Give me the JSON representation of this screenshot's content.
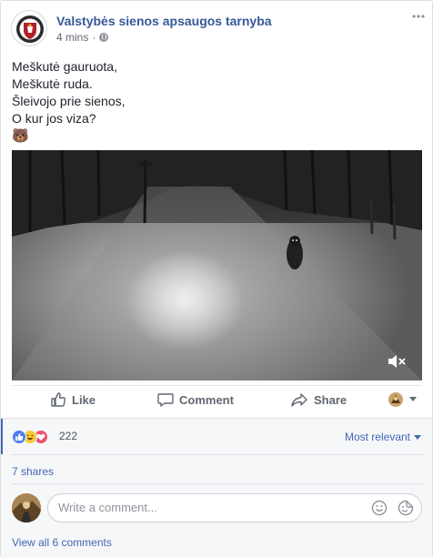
{
  "post": {
    "page_name": "Valstybės sienos apsaugos tarnyba",
    "time": "4 mins",
    "separator": "·",
    "more_icon": "more-dots-icon",
    "privacy_icon": "globe-icon",
    "text_lines": [
      "Meškutė gauruota,",
      "Meškutė ruda.",
      "Šleivojo prie sienos,",
      "O kur jos viza?"
    ],
    "emoji": "🐻",
    "video": {
      "muted": true,
      "mute_icon": "speaker-muted-icon"
    }
  },
  "actions": {
    "like": "Like",
    "comment": "Comment",
    "share": "Share"
  },
  "reactions": {
    "count": "222",
    "types": [
      "like",
      "haha",
      "love"
    ],
    "sort_label": "Most relevant"
  },
  "shares": "7 shares",
  "comment_box": {
    "placeholder": "Write a comment...",
    "icons": [
      "emoji-icon",
      "sticker-icon"
    ]
  },
  "view_all": "View all 6 comments",
  "colors": {
    "link": "#365899",
    "accent": "#4267b2",
    "like": "#4f7ff0",
    "haha": "#f7c934",
    "love": "#f0506e"
  }
}
